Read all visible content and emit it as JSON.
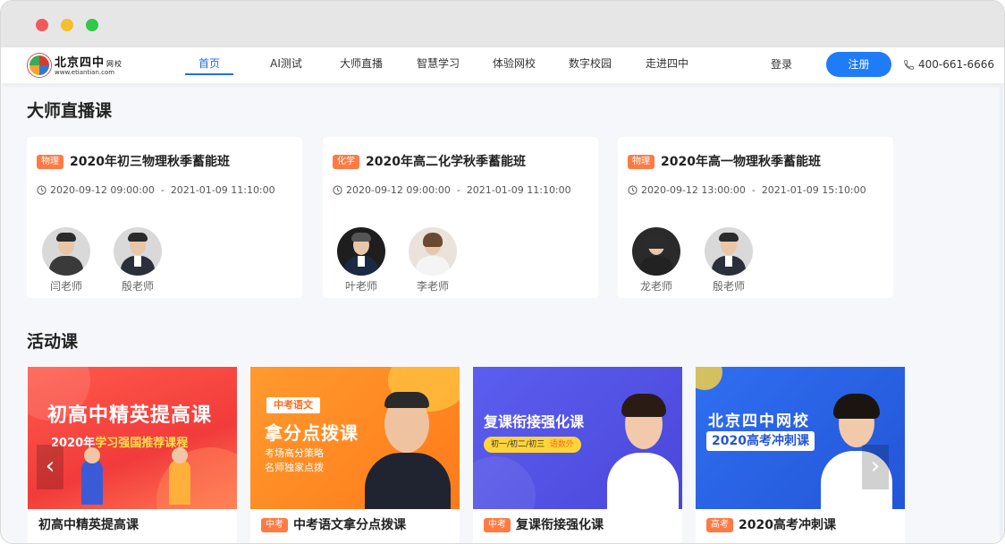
{
  "window": {
    "controls": [
      "close",
      "minimize",
      "maximize"
    ]
  },
  "header": {
    "logo_text": "北京四中",
    "logo_sub": "网校",
    "logo_url": "www.etiantian.com",
    "nav": [
      "首页",
      "AI测试",
      "大师直播",
      "智慧学习",
      "体验网校",
      "数字校园",
      "走进四中"
    ],
    "active_nav": "首页",
    "login": "登录",
    "register": "注册",
    "phone": "400-661-6666",
    "accent": "#1f7cf7"
  },
  "live_section": {
    "title": "大师直播课",
    "courses": [
      {
        "subject": "物理",
        "title": "2020年初三物理秋季蓄能班",
        "start": "2020-09-12 09:00:00",
        "sep": "-",
        "end": "2021-01-09 11:10:00",
        "teachers": [
          "闫老师",
          "殷老师"
        ]
      },
      {
        "subject": "化学",
        "title": "2020年高二化学秋季蓄能班",
        "start": "2020-09-12 09:00:00",
        "sep": "-",
        "end": "2021-01-09 11:10:00",
        "teachers": [
          "叶老师",
          "李老师"
        ]
      },
      {
        "subject": "物理",
        "title": "2020年高一物理秋季蓄能班",
        "start": "2020-09-12 13:00:00",
        "sep": "-",
        "end": "2021-01-09 15:10:00",
        "teachers": [
          "龙老师",
          "殷老师"
        ]
      }
    ]
  },
  "activity_section": {
    "title": "活动课",
    "items": [
      {
        "tag": "",
        "caption": "初高中精英提高课",
        "banner_line1": "初高中精英提高课",
        "banner_line2_a": "2020年",
        "banner_line2_b": "学习强国推荐课程"
      },
      {
        "tag": "中考",
        "caption": "中考语文拿分点拨课",
        "banner_badge": "中考语文",
        "banner_line1": "拿分点拨课",
        "banner_line2": "考场高分策略",
        "banner_line3": "名师独家点拨"
      },
      {
        "tag": "中考",
        "caption": "复课衔接强化课",
        "banner_line1": "复课衔接强化课",
        "banner_pill": "初一/初二/初三",
        "banner_pill2": "语数外"
      },
      {
        "tag": "高考",
        "caption": "2020高考冲刺课",
        "banner_line1": "北京四中网校",
        "banner_line2": "2020高考冲刺课"
      }
    ],
    "prev_arrow": "‹",
    "next_arrow": "›"
  }
}
